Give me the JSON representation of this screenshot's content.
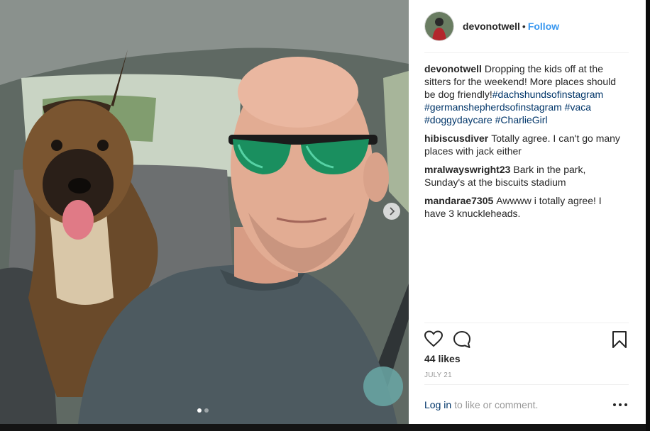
{
  "post": {
    "username": "devonotwell",
    "separator": "•",
    "follow_label": "Follow"
  },
  "comments": [
    {
      "author": "devonotwell",
      "text": "Dropping the kids off at the sitters for the weekend! More places should be dog friendly!",
      "hashtags": [
        "#dachshundsofinstagram",
        "#germanshepherdsofinstagram",
        "#vaca",
        "#doggydaycare",
        "#CharlieGirl"
      ]
    },
    {
      "author": "hibiscusdiver",
      "text": "Totally agree. I can't go many places with jack either"
    },
    {
      "author": "mralwayswright23",
      "text": "Bark in the park, Sunday's at the biscuits stadium"
    },
    {
      "author": "mandarae7305",
      "text": "Awwww i totally agree! I have 3 knuckleheads."
    }
  ],
  "likes": "44 likes",
  "date": "JULY 21",
  "footer": {
    "login_label": "Log in",
    "rest": "to like or comment."
  },
  "carousel": {
    "total_slides": 2,
    "active_slide": 1
  },
  "icons": {
    "like": "heart-icon",
    "comment": "comment-icon",
    "save": "bookmark-icon",
    "next": "chevron-right-icon",
    "more": "more-options-icon"
  },
  "colors": {
    "link_blue": "#3897f0",
    "hashtag": "#003569",
    "muted": "#999999"
  }
}
